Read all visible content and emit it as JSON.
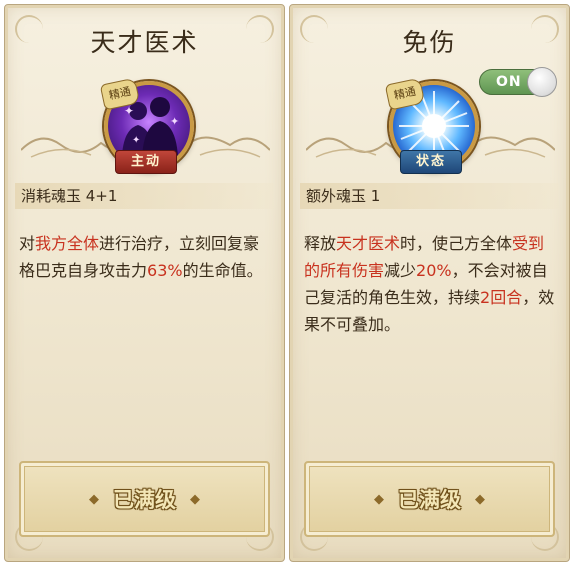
{
  "cards": [
    {
      "title": "天才医术",
      "rank_badge": "精通",
      "type_badge": "主动",
      "cost": "消耗魂玉 4+1",
      "desc": [
        {
          "t": "对",
          "hl": false
        },
        {
          "t": "我方全体",
          "hl": true
        },
        {
          "t": "进行治疗，立刻回复豪格巴克自身攻击力",
          "hl": false
        },
        {
          "t": "63%",
          "hl": true
        },
        {
          "t": "的生命值。",
          "hl": false
        }
      ],
      "max_button": "已满级",
      "icon": "party-silhouette-icon"
    },
    {
      "title": "免伤",
      "rank_badge": "精通",
      "type_badge": "状态",
      "cost": "额外魂玉 1",
      "toggle": "ON",
      "desc": [
        {
          "t": "释放",
          "hl": false
        },
        {
          "t": "天才医术",
          "hl": true
        },
        {
          "t": "时，使己方全体",
          "hl": false
        },
        {
          "t": "受到的所有伤害",
          "hl": true
        },
        {
          "t": "减少",
          "hl": false
        },
        {
          "t": "20%",
          "hl": true
        },
        {
          "t": "，不会对被自己复活的角色生效，持续",
          "hl": false
        },
        {
          "t": "2回合",
          "hl": true
        },
        {
          "t": "，效果不可叠加。",
          "hl": false
        }
      ],
      "max_button": "已满级",
      "icon": "blue-burst-icon"
    }
  ],
  "colors": {
    "highlight": "#c8321f",
    "text": "#3a2c1a",
    "toggle_on": "#6fa860"
  }
}
